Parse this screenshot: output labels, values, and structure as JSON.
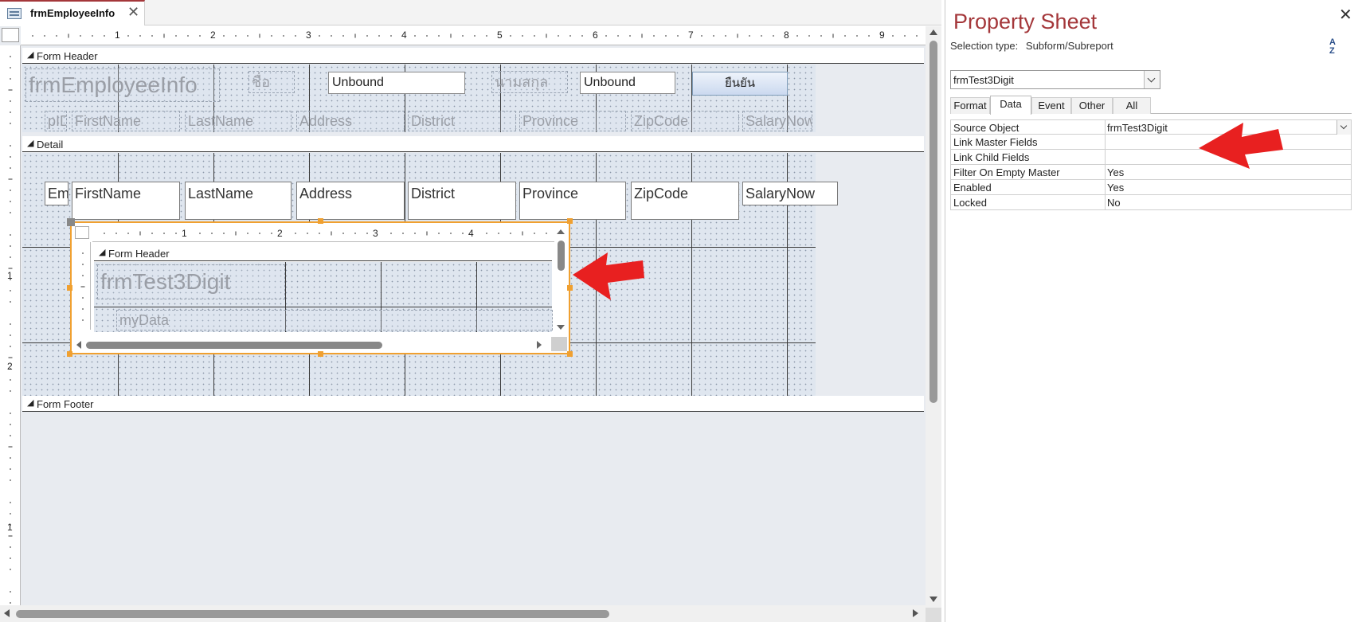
{
  "tab": {
    "title": "frmEmployeeInfo",
    "close": "✕"
  },
  "ruler": {
    "h": [
      "1",
      "2",
      "3",
      "4",
      "5",
      "6",
      "7",
      "8",
      "9"
    ],
    "v": [
      "1",
      "2",
      "1"
    ]
  },
  "sections": {
    "form_header": "Form Header",
    "detail": "Detail",
    "form_footer": "Form Footer"
  },
  "header": {
    "title_label": "frmEmployeeInfo",
    "name_label": "ชื่อ",
    "name_value": "Unbound",
    "surname_label": "นามสกุล",
    "surname_value": "Unbound",
    "confirm_button": "ยืนยัน",
    "column_labels": [
      "pID",
      "FirstName",
      "LastName",
      "Address",
      "District",
      "Province",
      "ZipCode",
      "SalaryNow"
    ]
  },
  "detail": {
    "fields": [
      "Em",
      "FirstName",
      "LastName",
      "Address",
      "District",
      "Province",
      "ZipCode",
      "SalaryNow"
    ]
  },
  "subform": {
    "ruler": [
      "1",
      "2",
      "3",
      "4"
    ],
    "section": "Form Header",
    "title_label": "frmTest3Digit",
    "field_label": "myData"
  },
  "property_sheet": {
    "title": "Property Sheet",
    "selection_label": "Selection type:",
    "selection_value": "Subform/Subreport",
    "sort_icon": "A↓Z",
    "object_combo": "frmTest3Digit",
    "close": "✕",
    "tabs": [
      "Format",
      "Data",
      "Event",
      "Other",
      "All"
    ],
    "active_tab": "Data",
    "rows": [
      {
        "name": "Source Object",
        "value": "frmTest3Digit"
      },
      {
        "name": "Link Master Fields",
        "value": ""
      },
      {
        "name": "Link Child Fields",
        "value": ""
      },
      {
        "name": "Filter On Empty Master",
        "value": "Yes"
      },
      {
        "name": "Enabled",
        "value": "Yes"
      },
      {
        "name": "Locked",
        "value": "No"
      }
    ]
  },
  "colors": {
    "accent": "#a4373a",
    "selection": "#f0a030",
    "annotation_arrow": "#e82020"
  }
}
